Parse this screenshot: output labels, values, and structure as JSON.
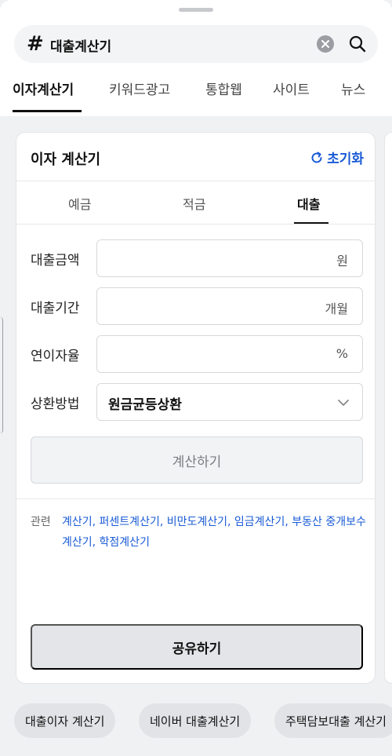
{
  "search": {
    "hash_symbol": "#",
    "query": "대출계산기",
    "icons": {
      "clear": "clear-icon",
      "search": "search-icon"
    }
  },
  "tabs": [
    {
      "label": "이자계산기",
      "active": true
    },
    {
      "label": "키워드광고",
      "active": false
    },
    {
      "label": "통합웹",
      "active": false
    },
    {
      "label": "사이트",
      "active": false
    },
    {
      "label": "뉴스",
      "active": false
    }
  ],
  "calculator": {
    "title": "이자 계산기",
    "reset_label": "초기화",
    "subtabs": [
      {
        "label": "예금",
        "active": false
      },
      {
        "label": "적금",
        "active": false
      },
      {
        "label": "대출",
        "active": true
      }
    ],
    "fields": {
      "amount": {
        "label": "대출금액",
        "unit": "원",
        "value": ""
      },
      "period": {
        "label": "대출기간",
        "unit": "개월",
        "value": ""
      },
      "rate": {
        "label": "연이자율",
        "unit": "%",
        "value": ""
      },
      "method": {
        "label": "상환방법",
        "selected": "원금균등상환"
      }
    },
    "calc_button": "계산하기",
    "related": {
      "label": "관련",
      "links": [
        "계산기",
        "퍼센트계산기",
        "비만도계산기",
        "임금계산기",
        "부동산 중개보수계산기",
        "학점계산기"
      ],
      "separator": ","
    },
    "share_button": "공유하기"
  },
  "chips": [
    "대출이자 계산기",
    "네이버 대출계산기",
    "주택담보대출 계산기"
  ],
  "colors": {
    "accent": "#1a5bd6",
    "background": "#f0f1f3"
  }
}
